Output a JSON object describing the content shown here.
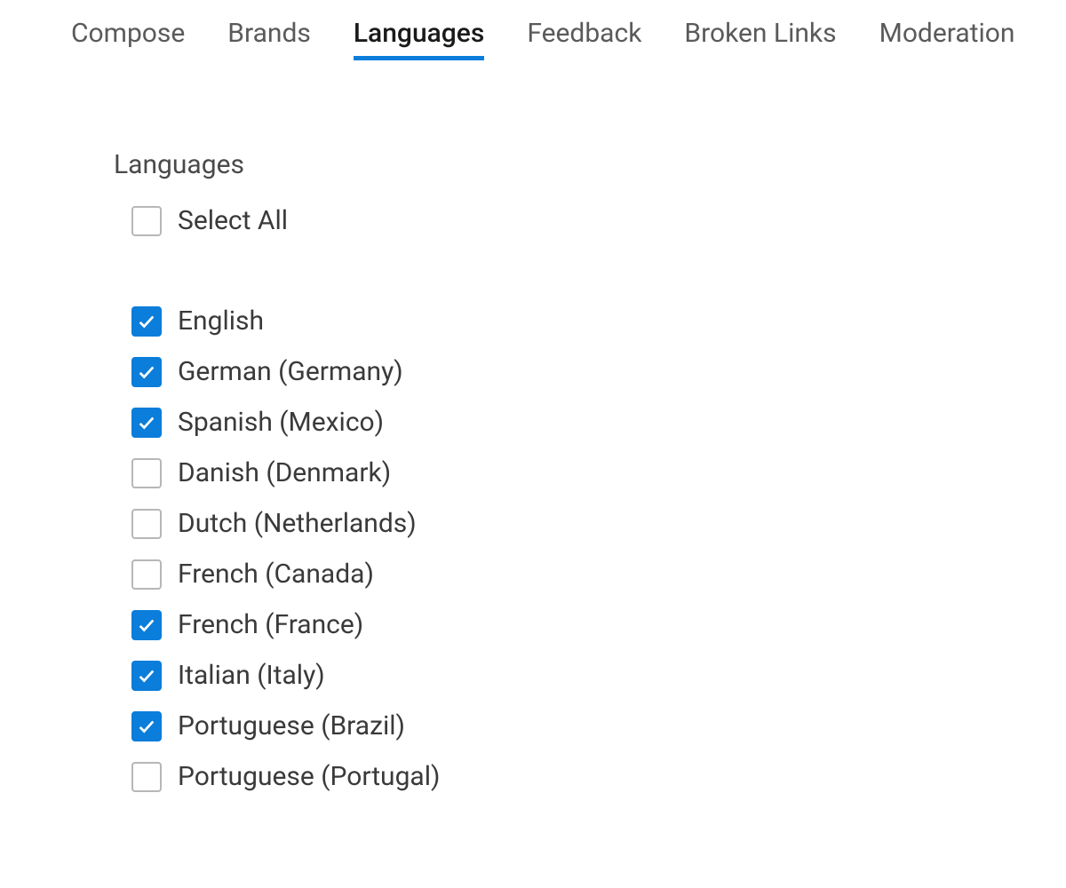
{
  "tabs": [
    {
      "label": "Compose",
      "active": false
    },
    {
      "label": "Brands",
      "active": false
    },
    {
      "label": "Languages",
      "active": true
    },
    {
      "label": "Feedback",
      "active": false
    },
    {
      "label": "Broken Links",
      "active": false
    },
    {
      "label": "Moderation",
      "active": false
    }
  ],
  "section": {
    "title": "Languages",
    "select_all_label": "Select All",
    "select_all_checked": false
  },
  "languages": [
    {
      "label": "English",
      "checked": true
    },
    {
      "label": "German (Germany)",
      "checked": true
    },
    {
      "label": "Spanish (Mexico)",
      "checked": true
    },
    {
      "label": "Danish (Denmark)",
      "checked": false
    },
    {
      "label": "Dutch (Netherlands)",
      "checked": false
    },
    {
      "label": "French (Canada)",
      "checked": false
    },
    {
      "label": "French (France)",
      "checked": true
    },
    {
      "label": "Italian (Italy)",
      "checked": true
    },
    {
      "label": "Portuguese (Brazil)",
      "checked": true
    },
    {
      "label": "Portuguese (Portugal)",
      "checked": false
    }
  ],
  "colors": {
    "accent": "#0b7dda"
  }
}
